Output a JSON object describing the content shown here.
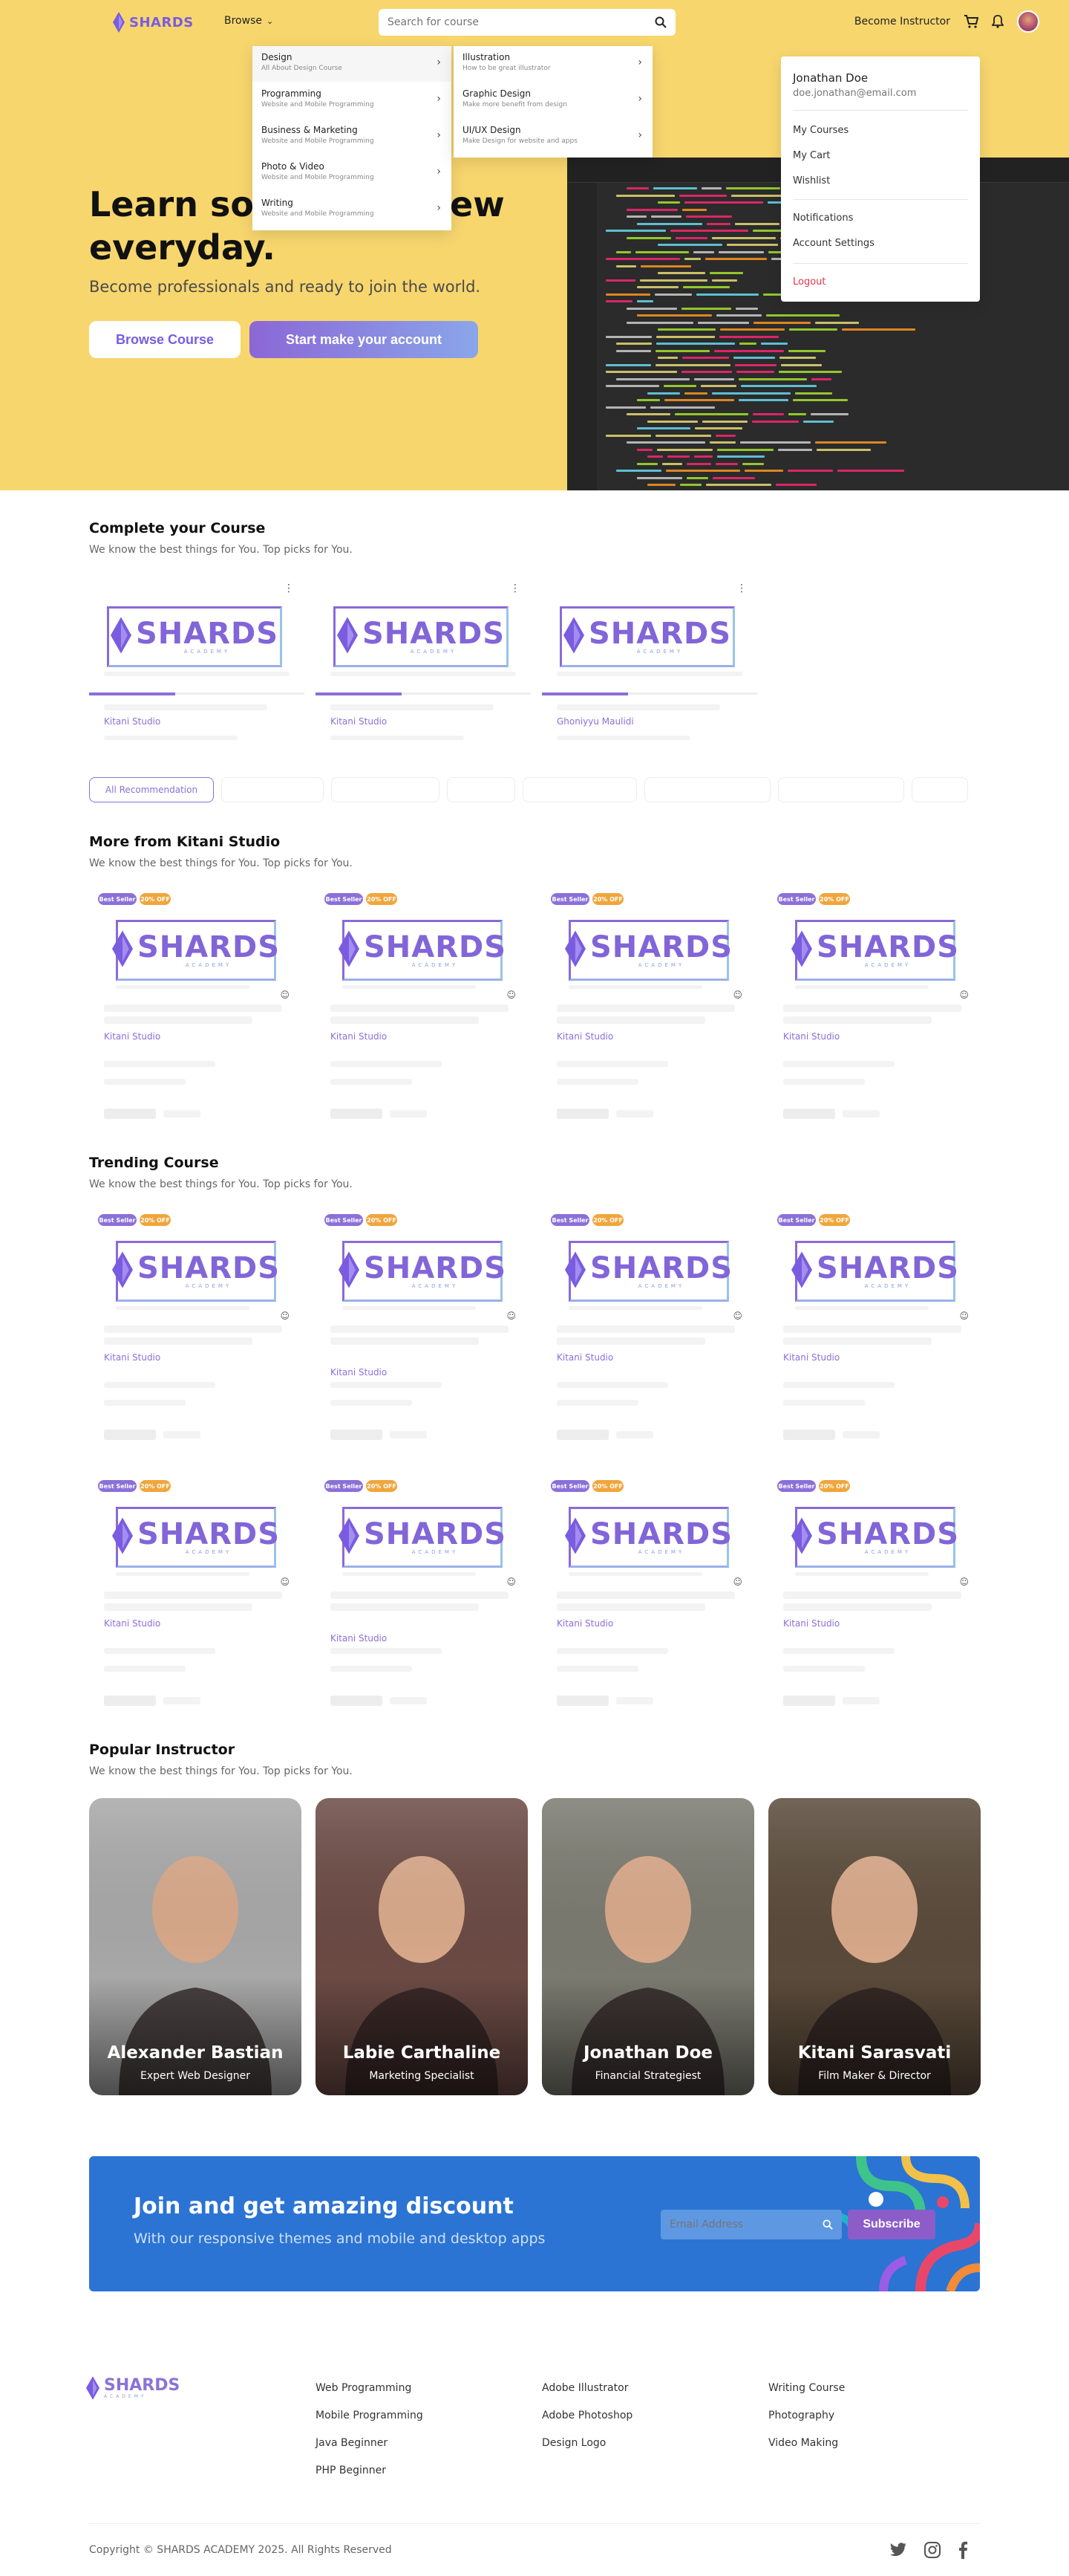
{
  "header": {
    "logo_text": "SHARDS",
    "browse_label": "Browse",
    "search_placeholder": "Search for course",
    "become_instructor": "Become Instructor"
  },
  "browse_menu": {
    "categories": [
      {
        "title": "Design",
        "desc": "All About Design Course"
      },
      {
        "title": "Programming",
        "desc": "Website and Mobile Programming"
      },
      {
        "title": "Business & Marketing",
        "desc": "Website and Mobile Programming"
      },
      {
        "title": "Photo & Video",
        "desc": "Website and Mobile Programming"
      },
      {
        "title": "Writing",
        "desc": "Website and Mobile Programming"
      }
    ],
    "subcategories": [
      {
        "title": "Illustration",
        "desc": "How to be great illustrator"
      },
      {
        "title": "Graphic Design",
        "desc": "Make more benefit from design"
      },
      {
        "title": "UI/UX Design",
        "desc": "Make Design for website and apps"
      }
    ]
  },
  "profile_menu": {
    "name": "Jonathan Doe",
    "email": "doe.jonathan@email.com",
    "items": [
      "My Courses",
      "My Cart",
      "Wishlist",
      "Notifications",
      "Account Settings"
    ],
    "logout": "Logout"
  },
  "hero": {
    "title": "Learn something new everyday.",
    "subtitle": "Become professionals and ready to join the world.",
    "btn_browse": "Browse Course",
    "btn_start": "Start make your account"
  },
  "complete_section": {
    "title": "Complete your Course",
    "subtitle": "We know the best things for You.  Top picks for You.",
    "cards": [
      {
        "studio": "Kitani Studio",
        "progress": 0.4
      },
      {
        "studio": "Kitani Studio",
        "progress": 0.4
      },
      {
        "studio": "Ghoniyyu Maulidi",
        "progress": 0.4
      }
    ]
  },
  "filter_chips": {
    "active": "All Recommendation"
  },
  "more_section": {
    "title": "More from Kitani Studio",
    "subtitle": "We know the best things for You.  Top picks for You.",
    "studio": "Kitani Studio",
    "best_seller": "Best Seller",
    "discount": "20% OFF"
  },
  "trending_section": {
    "title": "Trending Course",
    "subtitle": "We know the best things for You.  Top picks for You.",
    "studio": "Kitani Studio",
    "best_seller": "Best Seller",
    "discount": "20% OFF"
  },
  "card_logo": {
    "word": "SHARDS",
    "sub": "ACADEMY"
  },
  "instructors": {
    "title": "Popular Instructor",
    "subtitle": "We know the best things for You.  Top picks for You.",
    "list": [
      {
        "name": "Alexander Bastian",
        "role": "Expert Web Designer",
        "bg": "#a8a8a8"
      },
      {
        "name": "Labie Carthaline",
        "role": "Marketing Specialist",
        "bg": "#6b4a44"
      },
      {
        "name": "Jonathan Doe",
        "role": "Financial Strategiest",
        "bg": "#7a7a70"
      },
      {
        "name": "Kitani Sarasvati",
        "role": "Film Maker & Director",
        "bg": "#5a4a3a"
      }
    ]
  },
  "banner": {
    "title": "Join and get amazing discount",
    "subtitle": "With our responsive themes and mobile and desktop apps",
    "email_placeholder": "Email Address",
    "subscribe": "Subscribe"
  },
  "footer": {
    "logo_text": "SHARDS",
    "logo_sub": "ACADEMY",
    "col1": [
      "Web Programming",
      "Mobile Programming",
      "Java Beginner",
      "PHP Beginner"
    ],
    "col2": [
      "Adobe Illustrator",
      "Adobe Photoshop",
      "Design Logo"
    ],
    "col3": [
      "Writing Course",
      "Photography",
      "Video Making"
    ],
    "copyright": "Copyright © SHARDS ACADEMY 2025. All Rights Reserved"
  },
  "colors": {
    "header_bg": "#f7d66e",
    "accent": "#7a5ce0",
    "banner": "#2b74d3",
    "logout": "#e0384a"
  }
}
